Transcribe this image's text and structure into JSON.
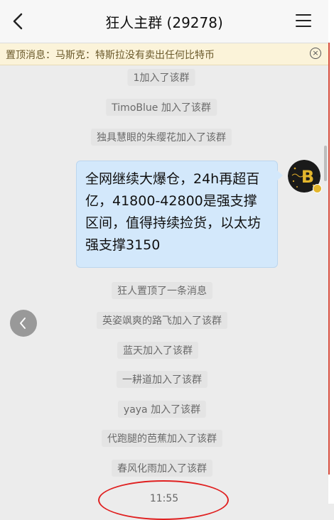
{
  "header": {
    "title": "狂人主群 (29278)"
  },
  "pinned": {
    "label": "置顶消息：",
    "text": "马斯克：特斯拉没有卖出任何比特币",
    "close_glyph": "×"
  },
  "system_messages": [
    "1加入了该群",
    "TimoBlue 加入了该群",
    "独具慧眼的朱缨花加入了该群",
    "狂人置顶了一条消息",
    "英姿飒爽的路飞加入了该群",
    "蓝天加入了该群",
    "一耕道加入了该群",
    "yaya 加入了该群",
    "代跑腿的芭蕉加入了该群",
    "春风化雨加入了该群"
  ],
  "message": {
    "text": "全网继续大爆仓，24h再超百亿，41800-42800是强支撑区间，值得持续捡货，以太坊强支撑3150"
  },
  "avatar": {
    "letter": "B",
    "icon": "bitcoin-avatar"
  },
  "timestamp": "11:55",
  "colors": {
    "bubble": "#d3e8fb",
    "pinned_bg": "#fbf3d9",
    "annotation_red": "#e02020",
    "avatar_gold": "#e3b62d"
  }
}
